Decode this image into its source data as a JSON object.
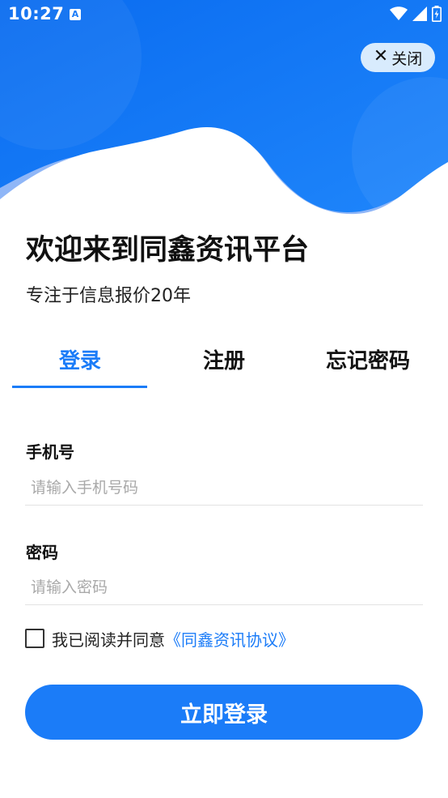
{
  "status_bar": {
    "time": "10:27",
    "notification_glyph": "A",
    "icons": [
      "wifi-icon",
      "signal-icon",
      "battery-icon"
    ]
  },
  "header": {
    "close_label": "关闭",
    "close_icon": "close-icon"
  },
  "welcome": {
    "title": "欢迎来到同鑫资讯平台",
    "subtitle": "专注于信息报价20年"
  },
  "tabs": [
    {
      "label": "登录",
      "active": true
    },
    {
      "label": "注册",
      "active": false
    },
    {
      "label": "忘记密码",
      "active": false
    }
  ],
  "form": {
    "phone": {
      "label": "手机号",
      "placeholder": "请输入手机号码",
      "value": ""
    },
    "password": {
      "label": "密码",
      "placeholder": "请输入密码",
      "value": ""
    },
    "agreement": {
      "text": "我已阅读并同意",
      "link": "《同鑫资讯协议》",
      "checked": false
    },
    "submit_label": "立即登录"
  },
  "colors": {
    "accent": "#1b7cf8",
    "hero_dark": "#0b6ef2",
    "hero_light": "#8fb6f7",
    "close_bg": "#d8ebfd",
    "divider": "#e2e2e2",
    "placeholder": "#a9a9a9"
  }
}
